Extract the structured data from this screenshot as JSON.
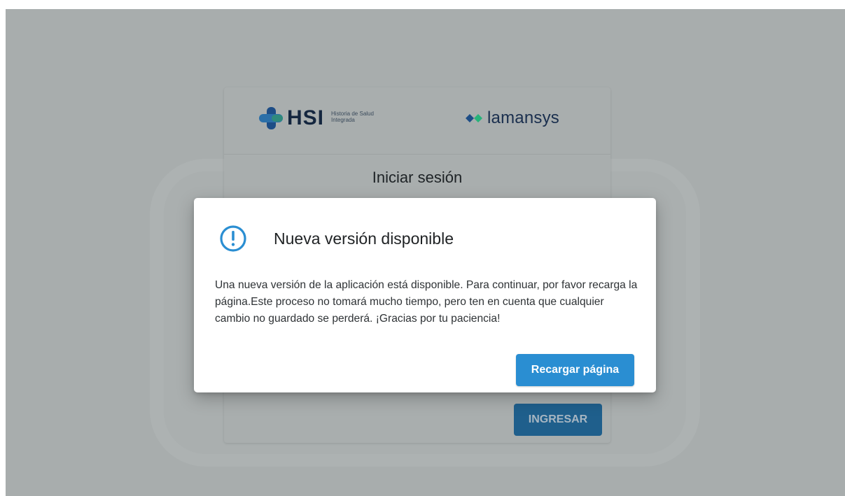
{
  "login_card": {
    "hsi_logo_text": "HSI",
    "hsi_logo_subtitle_line1": "Historia de Salud",
    "hsi_logo_subtitle_line2": "Integrada",
    "partner_logo_text": "lamansys",
    "title": "Iniciar sesión",
    "submit_label": "INGRESAR"
  },
  "dialog": {
    "icon": "exclamation-circle-icon",
    "title": "Nueva versión disponible",
    "message": "Una nueva versión de la aplicación está disponible. Para continuar, por favor recarga la página.Este proceso no tomará mucho tiempo, pero ten en cuenta que cualquier cambio no guardado se perderá. ¡Gracias por tu paciencia!",
    "reload_label": "Recargar página"
  },
  "colors": {
    "backdrop": "#a8adad",
    "primary_button": "#2a8ed2",
    "icon_accent": "#2a8ed2",
    "hsi_navy": "#14263f",
    "lamansys_green": "#27b37a"
  }
}
